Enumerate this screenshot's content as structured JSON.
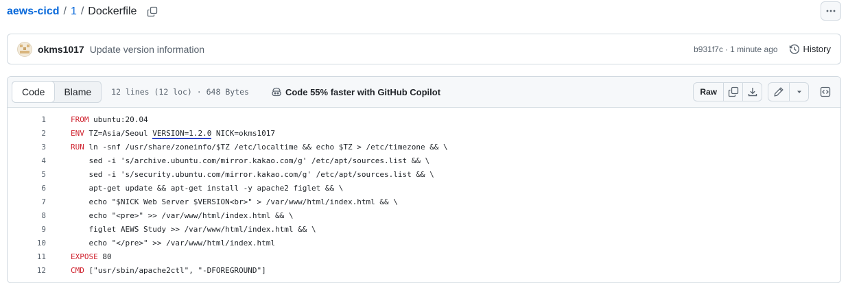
{
  "breadcrumb": {
    "repo": "aews-cicd",
    "sep1": "/",
    "folder": "1",
    "sep2": "/",
    "file": "Dockerfile"
  },
  "commit": {
    "author": "okms1017",
    "message": "Update version information",
    "sha": "b931f7c",
    "time": "· 1 minute ago",
    "history_label": "History"
  },
  "file": {
    "tabs": [
      {
        "label": "Code",
        "active": true
      },
      {
        "label": "Blame",
        "active": false
      }
    ],
    "meta": "12 lines (12 loc) · 648 Bytes",
    "copilot": "Code 55% faster with GitHub Copilot",
    "raw_label": "Raw"
  },
  "code_lines": [
    {
      "num": "1",
      "kw": "FROM",
      "rest": " ubuntu:20.04"
    },
    {
      "num": "2",
      "kw": "ENV",
      "rest": " TZ=Asia/Seoul ",
      "highlight": "VERSION=1.2.0",
      "rest2": " NICK=okms1017"
    },
    {
      "num": "3",
      "kw": "RUN",
      "rest": " ln -snf /usr/share/zoneinfo/$TZ /etc/localtime && echo $TZ > /etc/timezone && \\"
    },
    {
      "num": "4",
      "kw": "",
      "rest": "    sed -i 's/archive.ubuntu.com/mirror.kakao.com/g' /etc/apt/sources.list && \\"
    },
    {
      "num": "5",
      "kw": "",
      "rest": "    sed -i 's/security.ubuntu.com/mirror.kakao.com/g' /etc/apt/sources.list && \\"
    },
    {
      "num": "6",
      "kw": "",
      "rest": "    apt-get update && apt-get install -y apache2 figlet && \\"
    },
    {
      "num": "7",
      "kw": "",
      "rest": "    echo \"$NICK Web Server $VERSION<br>\" > /var/www/html/index.html && \\"
    },
    {
      "num": "8",
      "kw": "",
      "rest": "    echo \"<pre>\" >> /var/www/html/index.html && \\"
    },
    {
      "num": "9",
      "kw": "",
      "rest": "    figlet AEWS Study >> /var/www/html/index.html && \\"
    },
    {
      "num": "10",
      "kw": "",
      "rest": "    echo \"</pre>\" >> /var/www/html/index.html"
    },
    {
      "num": "11",
      "kw": "EXPOSE",
      "rest": " 80"
    },
    {
      "num": "12",
      "kw": "CMD",
      "rest": " [\"usr/sbin/apache2ctl\", \"-DFOREGROUND\"]"
    }
  ],
  "colors": {
    "link": "#0969da",
    "keyword": "#cf222e",
    "highlight_underline": "#2f45c9"
  }
}
